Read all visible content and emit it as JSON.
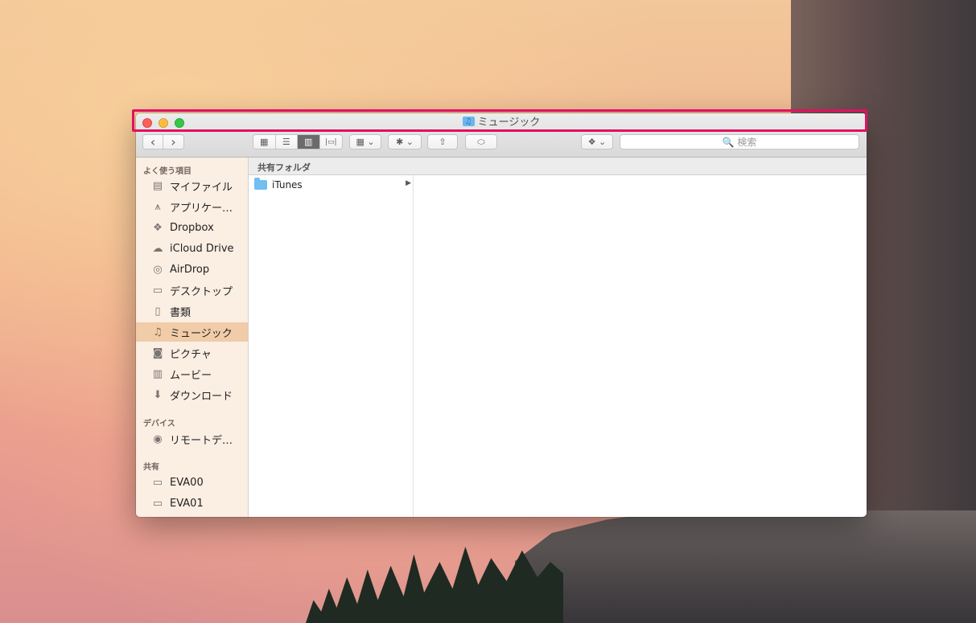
{
  "window": {
    "title": "ミュージック",
    "title_icon": "music-folder-icon"
  },
  "toolbar": {
    "back_icon": "‹",
    "forward_icon": "›",
    "view_icon_glyph": "▦",
    "view_list_glyph": "☰",
    "view_column_glyph": "▥",
    "view_coverflow_glyph": "|▭|",
    "arrange_glyph": "▦ ⌄",
    "action_glyph": "✱ ⌄",
    "share_glyph": "⇧",
    "tag_glyph": "⬭",
    "dropbox_glyph": "❖ ⌄",
    "search_placeholder": "🔍 検索"
  },
  "sidebar": {
    "favorites_header": "よく使う項目",
    "favorites": [
      {
        "label": "マイファイル",
        "icon": "all-files-icon",
        "glyph": "▤"
      },
      {
        "label": "アプリケー…",
        "icon": "applications-icon",
        "glyph": "⩚"
      },
      {
        "label": "Dropbox",
        "icon": "dropbox-icon",
        "glyph": "❖"
      },
      {
        "label": "iCloud Drive",
        "icon": "cloud-icon",
        "glyph": "☁"
      },
      {
        "label": "AirDrop",
        "icon": "airdrop-icon",
        "glyph": "◎"
      },
      {
        "label": "デスクトップ",
        "icon": "desktop-icon",
        "glyph": "▭"
      },
      {
        "label": "書類",
        "icon": "documents-icon",
        "glyph": "▯"
      },
      {
        "label": "ミュージック",
        "icon": "music-note-icon",
        "glyph": "♫",
        "selected": true
      },
      {
        "label": "ピクチャ",
        "icon": "camera-icon",
        "glyph": "◙"
      },
      {
        "label": "ムービー",
        "icon": "film-icon",
        "glyph": "▥"
      },
      {
        "label": "ダウンロード",
        "icon": "download-icon",
        "glyph": "⬇"
      }
    ],
    "devices_header": "デバイス",
    "devices": [
      {
        "label": "リモートデ…",
        "icon": "remote-disc-icon",
        "glyph": "◉"
      }
    ],
    "shared_header": "共有",
    "shared": [
      {
        "label": "EVA00",
        "icon": "computer-icon",
        "glyph": "▭"
      },
      {
        "label": "EVA01",
        "icon": "computer-icon",
        "glyph": "▭"
      }
    ]
  },
  "pathbar": {
    "label": "共有フォルダ"
  },
  "columns": [
    {
      "items": [
        {
          "label": "iTunes",
          "has_children": true,
          "arrow": "▶"
        }
      ]
    }
  ]
}
